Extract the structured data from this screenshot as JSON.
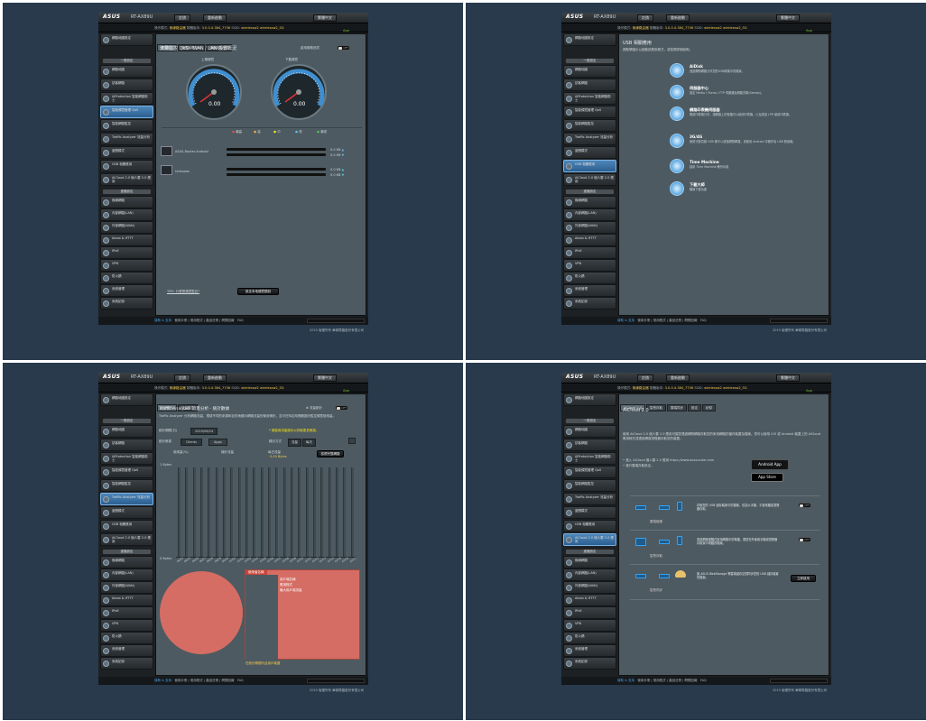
{
  "brand": "ASUS",
  "model": "RT-AX89U",
  "top_buttons": [
    "註銷",
    "重新啟動",
    "繁體中文"
  ],
  "info": {
    "mode_label": "操作模式:",
    "mode": "無線路由器",
    "fw_label": "韌體版本:",
    "fw": "3.0.0.4.384_7756",
    "ssid_label": "SSID:",
    "ssid": "wirelessw2 wirelessw2_5G",
    "app": "App"
  },
  "sidebar": {
    "setup": "網路地圖設定",
    "general": "一般設定",
    "general_items": [
      "網路地圖",
      "訪客網路",
      "AiProtection 智能網路衛士",
      "智能頻寬管理 QoS",
      "智能網路監控",
      "Traffic Analyzer 流量分析",
      "遊戲模式",
      "USB 相關應用",
      "AiCloud 2.0 個人雲 2.0 應用"
    ],
    "advanced": "進階設定",
    "advanced_items": [
      "無線網路",
      "內部網路(LAN)",
      "外部網路(WAN)",
      "Alexa & IFTTT",
      "IPv6",
      "VPN",
      "防火牆",
      "系統管理",
      "系統記錄",
      "網路工具"
    ]
  },
  "footer": {
    "help": "幫助 & 支持",
    "links": "使用手冊 | 常用程式 | 產品註冊 | 問題回報",
    "faq": "FAQ",
    "copyright": "2019 版權所有 華碩電腦股份有限公司"
  },
  "q1": {
    "tabs": [
      "頻寬監控",
      "頻寬管理 QoS",
      "傳統服務品質"
    ],
    "title": "流量監控 QoS - WAN / LAN 設置概況",
    "qos_label": "啟用服務品質",
    "toggle": "OFF",
    "gauges": [
      {
        "label": "上傳頻寬",
        "value": "0.00"
      },
      {
        "label": "下載頻寬",
        "value": "0.00"
      }
    ],
    "legend": [
      "最高",
      "高",
      "中",
      "低",
      "最低"
    ],
    "legend_colors": [
      "#d9534f",
      "#f0ad4e",
      "#f7e11a",
      "#5bc0de",
      "#5cb85c"
    ],
    "devices": [
      {
        "name": "ASUS-Router-Android",
        "up": "0.0 KB",
        "down": "0.0 KB"
      },
      {
        "name": "Unknown",
        "up": "0.0 KB",
        "down": "0.0 KB"
      }
    ],
    "tips": "TIPS: 什麼是頻寬監控?",
    "apply": "設定本地頻寬限制"
  },
  "q2": {
    "title": "USB 相關應用",
    "subtitle": "請點擊圖示以啟動該應用程式，或檢視詳細說明。",
    "apps": [
      {
        "name": "AiDisk",
        "desc": "透過網際網路分享您的USB硬碟中的檔案。"
      },
      {
        "name": "伺服器中心",
        "desc": "設定 Media / iTunes / FTP 伺服器及網路芳鄰(Samba)。"
      },
      {
        "name": "網路印表機伺服器",
        "desc": "開啟印表機分享，讓網路上的電腦可以使用印表機，以及透過 LPR 使用印表機。"
      },
      {
        "name": "3G/4G",
        "desc": "使用行動寬頻 USB 網卡以連接網際網路，或使用 Android 手機作為 USB 數據機。"
      },
      {
        "name": "Time Machine",
        "desc": "啟用 Time Machine 備份功能"
      },
      {
        "name": "下載大師",
        "desc": "離線下載功能"
      }
    ]
  },
  "q3": {
    "tabs": [
      "統計資料",
      "流量監控"
    ],
    "title": "Traffic Analyzer 流量分析 - 統計數據",
    "enable_label": "流量統計",
    "toggle": "OFF",
    "desc": "Traffic Analyzer 分析網路流量，根據不同的來源和目的地顯示網路流量的使用情形，並可在特定時間範圍內監控頻寬使用量。",
    "warn": "* 請啟用流量統計以存取更多數據。",
    "period_label": "統計期間(日)",
    "period": "2019/06/24",
    "display_label": "顯示方式",
    "display_select": [
      "流量",
      "每天"
    ],
    "type_label": "統計數據",
    "type_tabs": [
      "Clients",
      "Apps"
    ],
    "cols": [
      "使用量(%)",
      "總計流量",
      "每日流量"
    ],
    "col_value": "0.00 Bytes",
    "view_btn": "檢視完整網路",
    "chart_data": {
      "type": "bar",
      "categories": [
        "06/24",
        "06/25",
        "06/26",
        "06/27",
        "06/28",
        "06/29",
        "06/30",
        "07/01",
        "07/02",
        "07/03",
        "07/04",
        "07/05",
        "07/06",
        "07/07",
        "07/08",
        "07/09",
        "07/10",
        "07/11",
        "07/12",
        "07/13",
        "07/14",
        "07/15",
        "07/16",
        "07/17"
      ],
      "values": [
        0,
        0,
        0,
        0,
        0,
        0,
        0,
        0,
        0,
        0,
        0,
        0,
        0,
        0,
        0,
        0,
        0,
        0,
        0,
        0,
        0,
        0,
        0,
        0,
        0
      ],
      "yticks": [
        "1 Bytes",
        "0 Bytes"
      ],
      "ylim": [
        0,
        1
      ]
    },
    "pie_label": "使用量",
    "panel_head": "使用者名稱",
    "panel_items": [
      "用戶端名稱",
      "應用程式",
      "最大用戶端流量"
    ],
    "panel_note": "在統計期間內此用戶裝置"
  },
  "q4": {
    "tabs": [
      "AiCloud 2.0",
      "智慧存取",
      "雲端同步",
      "設定",
      "紀錄"
    ],
    "title": "AiCloud 2.0",
    "desc": "使用 AiCloud 2.0 個人雲 2.0 應用可讓您透過網際網路存取您的家用網路的儲存裝置及檔案。您可以使用 iOS 或 Android 裝置上的 AiCloud 應用程式或透過網頁瀏覽器存取您的裝置。",
    "bullets": [
      "進入 AiCloud 個人雲 2.0 應用 https://www.asusrouter.com",
      "進行雲端存取設定。"
    ],
    "android": "Android App",
    "appstore": "App Store",
    "features": [
      {
        "label": "雲端磁碟",
        "text": "存取您的 USB 儲存裝置中的檔案，包括以手機、平板電腦或瀏覽器存取。",
        "toggle": "OFF"
      },
      {
        "label": "智慧存取",
        "text": "透過網路喚醒在家用網路中的電腦，讓您在外使用手機或瀏覽器存取家中電腦的檔案。",
        "toggle": "OFF"
      },
      {
        "label": "智慧同步",
        "text": "與 ASUS WebStorage 等雲端儲存空間同步您的 USB 儲存裝置的檔案。",
        "btn": "立即啟用"
      }
    ]
  }
}
